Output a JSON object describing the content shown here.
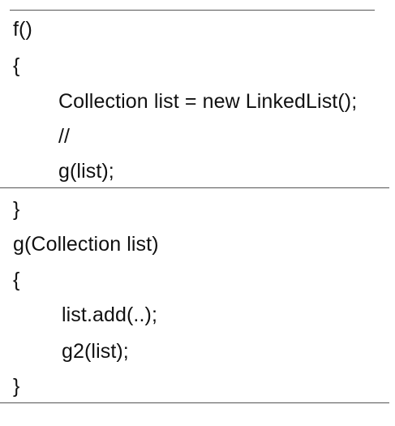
{
  "code_block_1": {
    "lines": [
      "f()",
      "{",
      "Collection list = new LinkedList();",
      "//",
      "g(list);"
    ]
  },
  "code_block_2": {
    "lines": [
      "}",
      "g(Collection list)",
      "{",
      "list.add(..);",
      "g2(list);",
      "}"
    ]
  }
}
